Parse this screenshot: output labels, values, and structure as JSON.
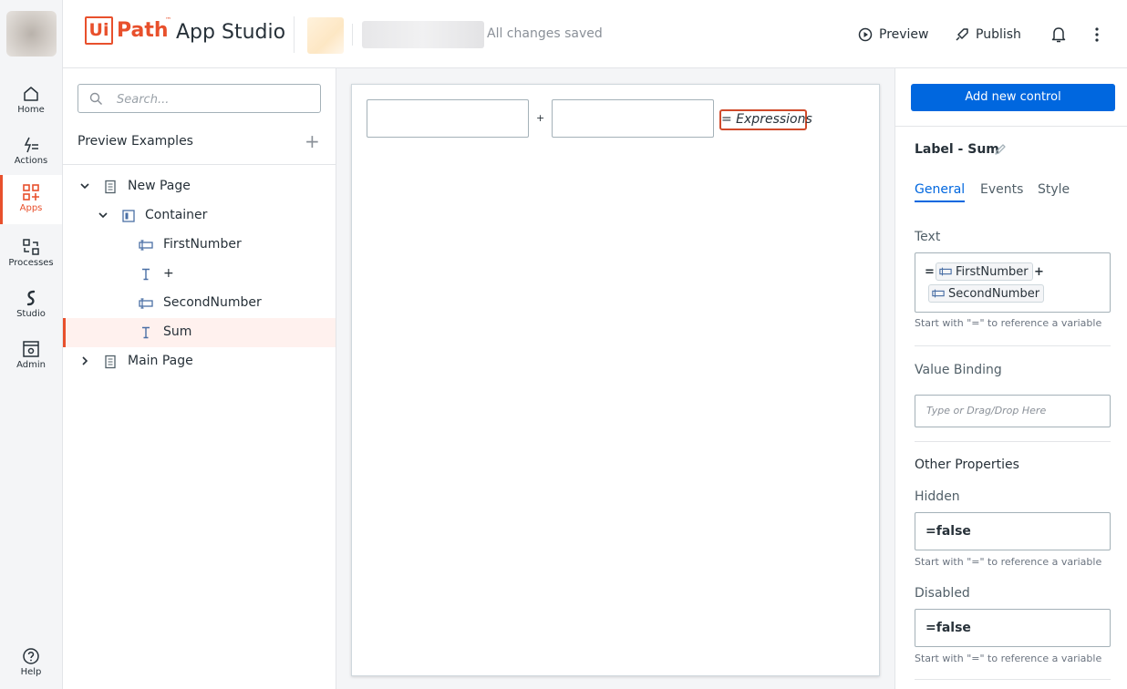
{
  "rail": {
    "items": [
      {
        "label": "Home",
        "icon": "home-icon"
      },
      {
        "label": "Actions",
        "icon": "actions-icon"
      },
      {
        "label": "Apps",
        "icon": "apps-icon",
        "active": true
      },
      {
        "label": "Processes",
        "icon": "processes-icon"
      },
      {
        "label": "Studio",
        "icon": "studio-icon"
      },
      {
        "label": "Admin",
        "icon": "admin-icon"
      }
    ],
    "help_label": "Help"
  },
  "header": {
    "logo_ui": "Ui",
    "logo_path": "Path",
    "logo_tm": "™",
    "app_name": "App Studio",
    "save_status": "All changes saved",
    "preview_label": "Preview",
    "publish_label": "Publish"
  },
  "tree": {
    "search_placeholder": "Search...",
    "project_title": "Preview Examples",
    "add_symbol": "+",
    "nodes": [
      {
        "label": "New Page",
        "type": "page",
        "expanded": true
      },
      {
        "label": "Container",
        "type": "container",
        "expanded": true
      },
      {
        "label": "FirstNumber",
        "type": "textbox"
      },
      {
        "label": "+",
        "type": "label"
      },
      {
        "label": "SecondNumber",
        "type": "textbox"
      },
      {
        "label": "Sum",
        "type": "label",
        "selected": true
      },
      {
        "label": "Main Page",
        "type": "page",
        "expanded": false
      }
    ]
  },
  "canvas": {
    "plus_label": "+",
    "expression_label": "= Expressions"
  },
  "props": {
    "add_control_label": "Add new control",
    "control_name": "Label - Sum",
    "tabs": [
      "General",
      "Events",
      "Style"
    ],
    "active_tab": "General",
    "text_label": "Text",
    "text_expr_prefix": "=",
    "text_chip1": "FirstNumber",
    "text_plus": "+",
    "text_chip2": "SecondNumber",
    "hint": "Start with \"=\" to reference a variable",
    "value_binding_label": "Value Binding",
    "value_binding_placeholder": "Type or Drag/Drop Here",
    "other_props_label": "Other Properties",
    "hidden_label": "Hidden",
    "hidden_value": "=false",
    "disabled_label": "Disabled",
    "disabled_value": "=false"
  },
  "colors": {
    "brand": "#e8502c",
    "primary": "#0067df",
    "selected_bg": "#fff1ee"
  }
}
